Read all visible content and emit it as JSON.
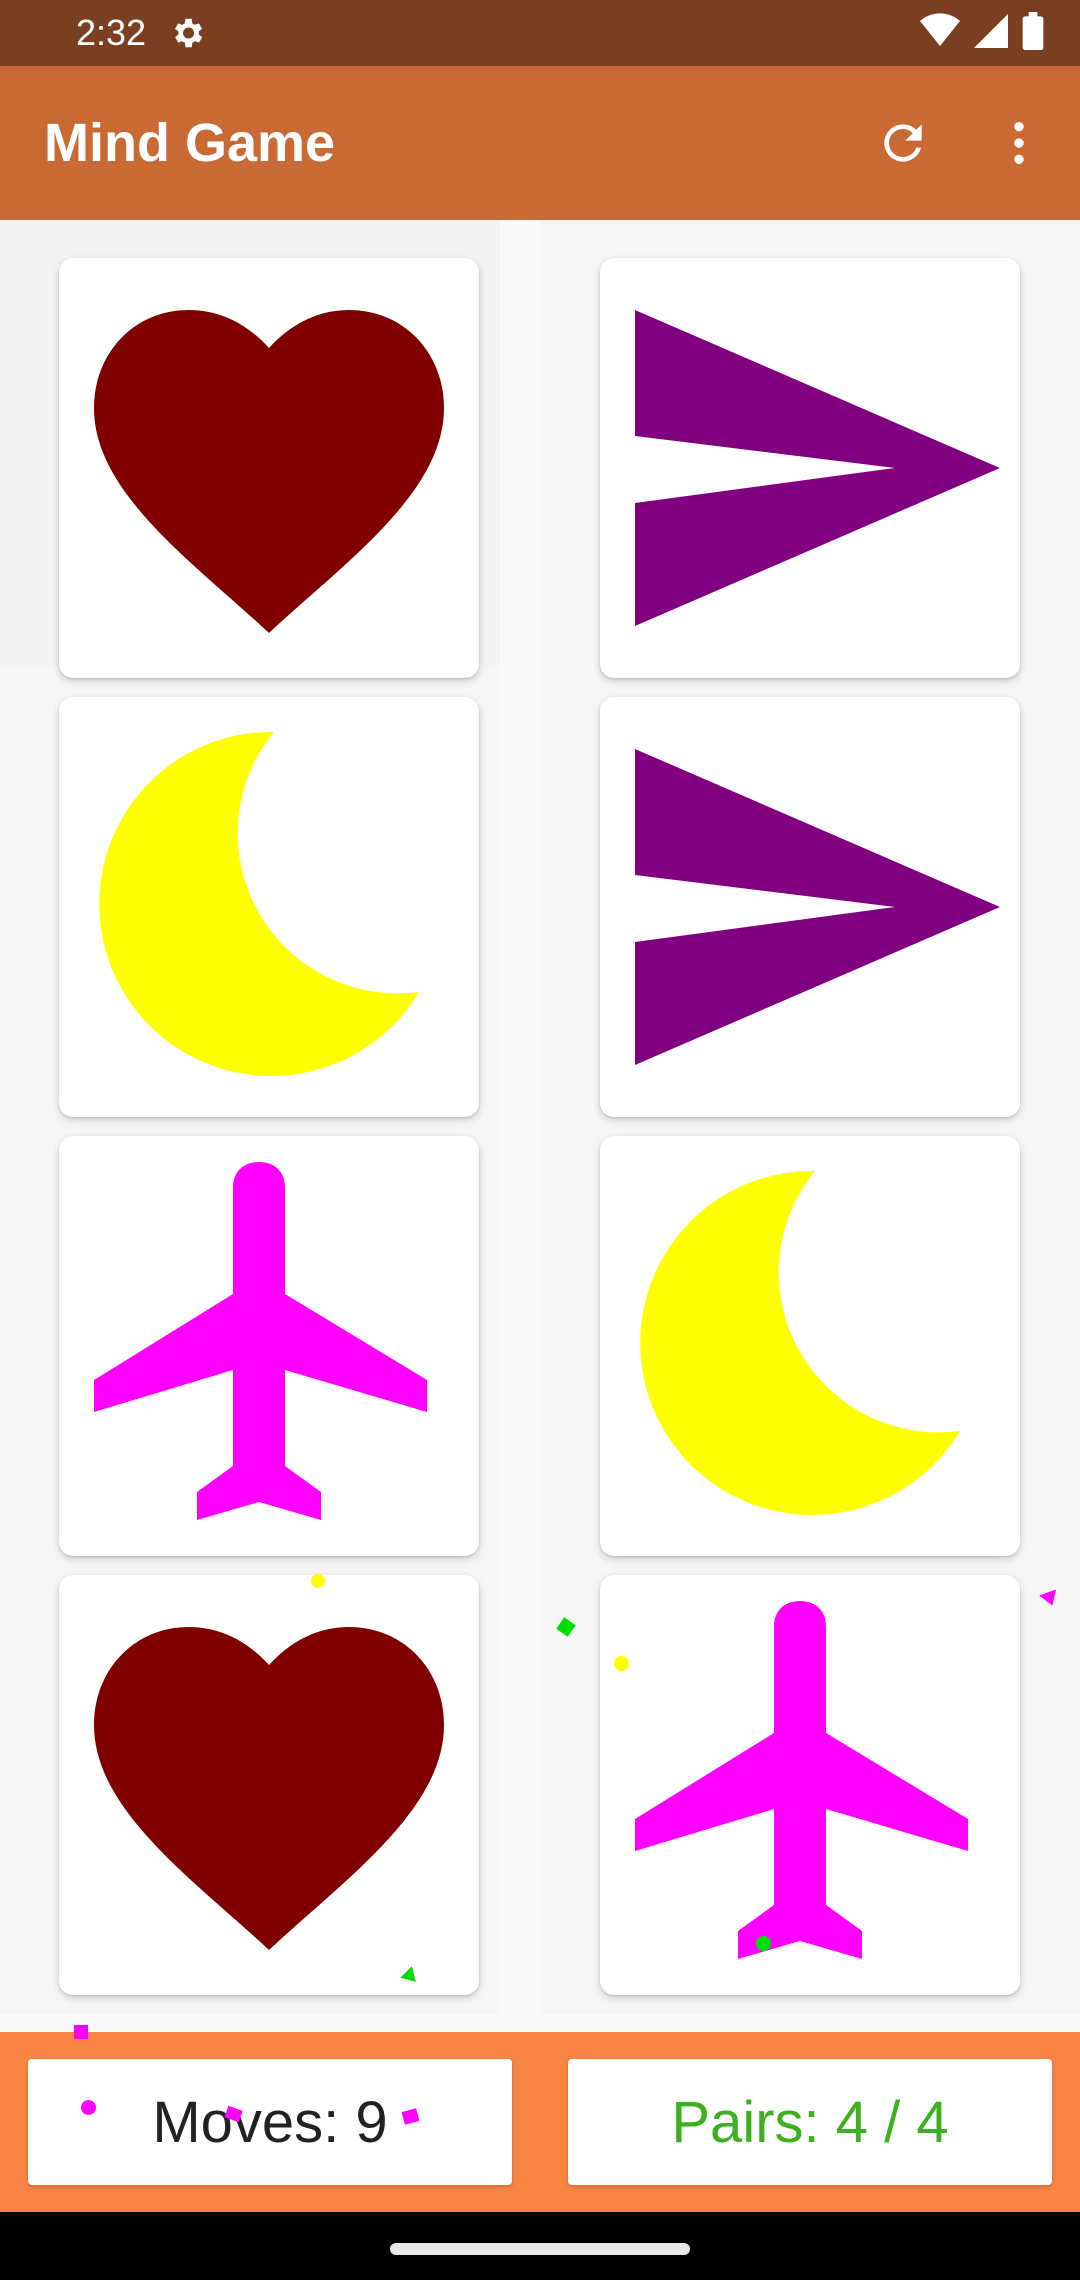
{
  "status_bar": {
    "time": "2:32",
    "icons": [
      "gear-icon",
      "wifi-icon",
      "signal-icon",
      "battery-icon"
    ]
  },
  "app_bar": {
    "title": "Mind Game",
    "actions": [
      "refresh-icon",
      "more-vert-icon"
    ],
    "color": "#c96a35"
  },
  "board": {
    "columns": 2,
    "cards": [
      {
        "symbol": "heart",
        "color": "#800000",
        "face_up": true
      },
      {
        "symbol": "arrowhead",
        "color": "#800080",
        "face_up": true
      },
      {
        "symbol": "moon",
        "color": "#ffff00",
        "face_up": true
      },
      {
        "symbol": "arrowhead",
        "color": "#800080",
        "face_up": true
      },
      {
        "symbol": "airplane",
        "color": "#ff00ff",
        "face_up": true
      },
      {
        "symbol": "moon",
        "color": "#ffff00",
        "face_up": true
      },
      {
        "symbol": "heart",
        "color": "#800000",
        "face_up": true
      },
      {
        "symbol": "airplane",
        "color": "#ff00ff",
        "face_up": true
      }
    ]
  },
  "stats": {
    "moves": "Moves: 9",
    "pairs": "Pairs: 4 / 4",
    "moves_color": "#222222",
    "pairs_color": "#3cb01e"
  },
  "colors": {
    "status_bar": "#7a3f20",
    "bottom_bar": "#f98545"
  }
}
